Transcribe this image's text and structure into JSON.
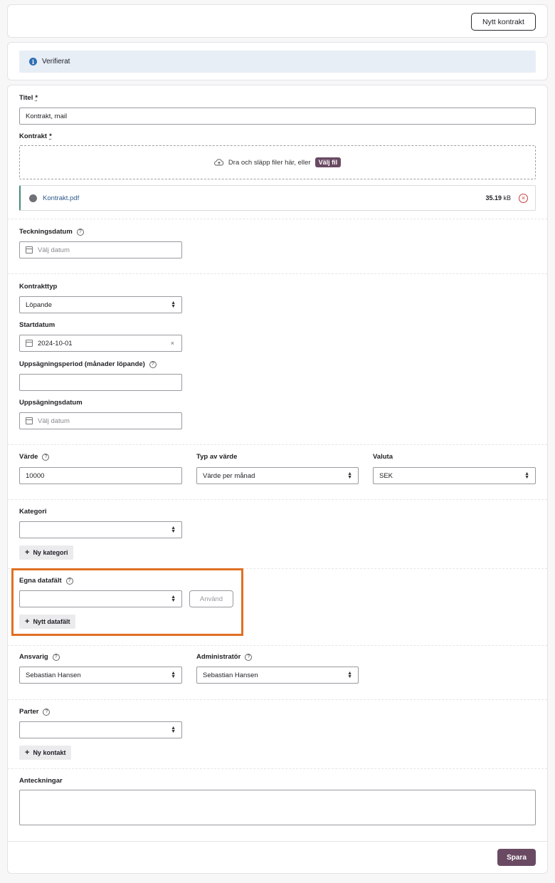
{
  "header": {
    "new_contract_label": "Nytt kontrakt"
  },
  "status": {
    "text": "Verifierat",
    "icon": "info-icon"
  },
  "form": {
    "title": {
      "label": "Titel",
      "required_mark": "*",
      "value": "Kontrakt, mail"
    },
    "contract": {
      "label": "Kontrakt",
      "required_mark": "*",
      "dropzone_text": "Dra och släpp filer här, eller",
      "choose_file_label": "Välj fil",
      "file": {
        "name": "Kontrakt.pdf",
        "size_value": "35.19",
        "size_unit": "kB"
      }
    },
    "signing_date": {
      "label": "Teckningsdatum",
      "placeholder": "Välj datum"
    },
    "contract_type": {
      "label": "Kontrakttyp",
      "value": "Löpande"
    },
    "start_date": {
      "label": "Startdatum",
      "value": "2024-10-01",
      "clear_label": "×"
    },
    "notice_period": {
      "label": "Uppsägningsperiod (månader löpande)",
      "value": ""
    },
    "termination_date": {
      "label": "Uppsägningsdatum",
      "placeholder": "Välj datum"
    },
    "value": {
      "label": "Värde",
      "value": "10000"
    },
    "value_type": {
      "label": "Typ av värde",
      "value": "Värde per månad"
    },
    "currency": {
      "label": "Valuta",
      "value": "SEK"
    },
    "category": {
      "label": "Kategori",
      "value": "",
      "add_label": "Ny kategori"
    },
    "custom_fields": {
      "label": "Egna datafält",
      "value": "",
      "apply_label": "Använd",
      "add_label": "Nytt datafält"
    },
    "responsible": {
      "label": "Ansvarig",
      "value": "Sebastian Hansen"
    },
    "administrator": {
      "label": "Administratör",
      "value": "Sebastian Hansen"
    },
    "parties": {
      "label": "Parter",
      "value": "",
      "add_label": "Ny kontakt"
    },
    "notes": {
      "label": "Anteckningar",
      "value": ""
    },
    "save_label": "Spara"
  },
  "colors": {
    "accent": "#6a4a63",
    "highlight": "#e07024",
    "alert_bg": "#e7eef6",
    "info": "#2f6fb3",
    "error": "#c84040"
  }
}
